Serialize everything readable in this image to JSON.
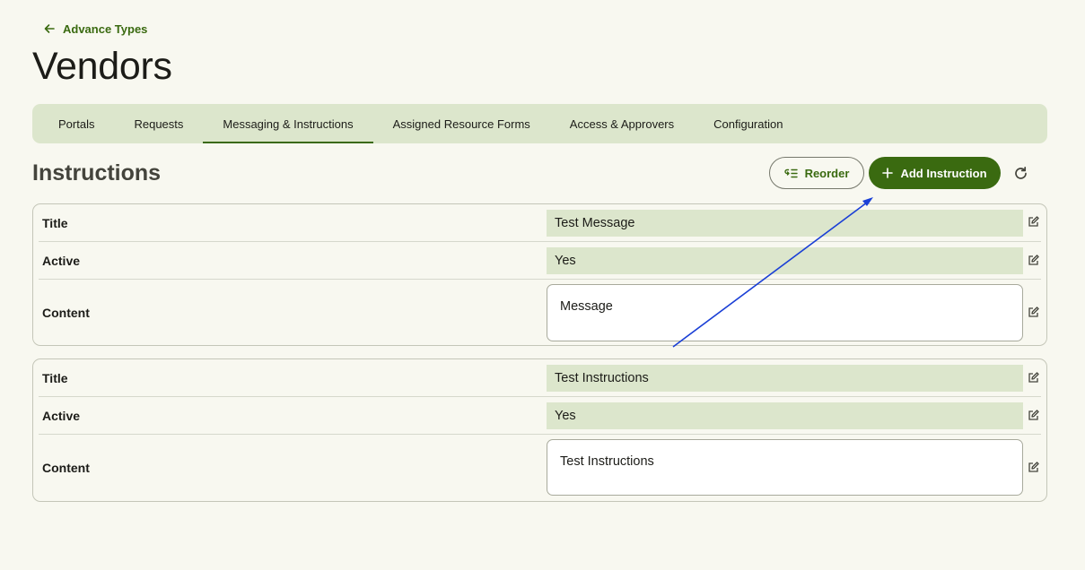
{
  "breadcrumb": {
    "back_label": "Advance Types"
  },
  "page": {
    "title": "Vendors"
  },
  "tabs": [
    {
      "label": "Portals"
    },
    {
      "label": "Requests"
    },
    {
      "label": "Messaging & Instructions",
      "active": true
    },
    {
      "label": "Assigned Resource Forms"
    },
    {
      "label": "Access & Approvers"
    },
    {
      "label": "Configuration"
    }
  ],
  "section": {
    "title": "Instructions",
    "reorder_label": "Reorder",
    "add_label": "Add Instruction"
  },
  "instructions": [
    {
      "title_label": "Title",
      "title_value": "Test Message",
      "active_label": "Active",
      "active_value": "Yes",
      "content_label": "Content",
      "content_value": "Message"
    },
    {
      "title_label": "Title",
      "title_value": "Test Instructions",
      "active_label": "Active",
      "active_value": "Yes",
      "content_label": "Content",
      "content_value": "Test Instructions"
    }
  ],
  "colors": {
    "primary": "#3a6a10",
    "surface": "#f8f8f0",
    "tab_bar": "#dce6cc",
    "annotation": "#1a3fd6"
  },
  "icons": {
    "back": "arrow-left-icon",
    "reorder": "reorder-list-icon",
    "add": "plus-icon",
    "refresh": "refresh-icon",
    "edit": "edit-icon"
  }
}
